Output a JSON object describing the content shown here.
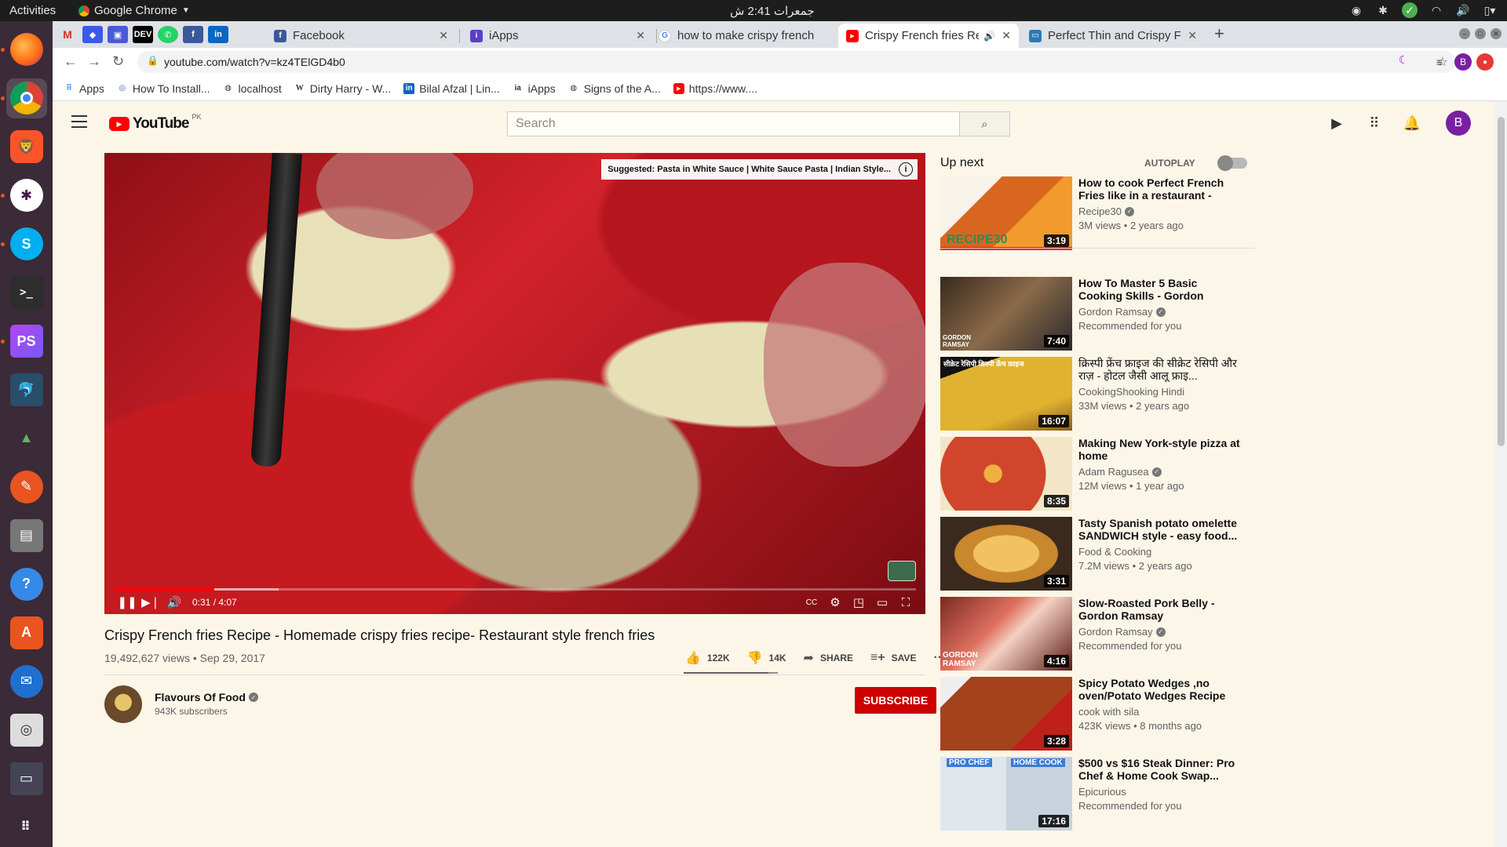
{
  "os": {
    "activities": "Activities",
    "app_menu": "Google Chrome",
    "clock": "جمعرات 2:41 ش"
  },
  "dock": [
    "firefox",
    "chrome",
    "brave",
    "slack",
    "skype",
    "terminal",
    "phpstorm",
    "mysql-workbench",
    "inkscape",
    "scratch",
    "files",
    "help",
    "software-center",
    "thunderbird",
    "rhythmbox",
    "screen",
    "show-apps"
  ],
  "browser": {
    "pinned_tabs": [
      "gmail",
      "plex",
      "app",
      "dev",
      "whatsapp",
      "facebook",
      "linkedin"
    ],
    "tabs": [
      {
        "title": "Facebook",
        "fav_color": "#3b5998",
        "fav": "f"
      },
      {
        "title": "iApps",
        "fav_color": "#5a3ec8",
        "fav": "i"
      },
      {
        "title": "how to make crispy french",
        "fav_color": "#4285f4",
        "fav": "G"
      },
      {
        "title": "Crispy French fries Rec",
        "fav_color": "#f00",
        "fav": "▶",
        "active": true
      },
      {
        "title": "Perfect Thin and Crispy Fr",
        "fav_color": "#2a7ab8",
        "fav": "▭"
      }
    ],
    "url": "youtube.com/watch?v=kz4TElGD4b0",
    "profile_initial": "B",
    "bookmarks": [
      {
        "label": "Apps",
        "icon": "apps-grid-icon"
      },
      {
        "label": "How To Install...",
        "icon": "blue-swirl-icon"
      },
      {
        "label": "localhost",
        "icon": "globe-icon"
      },
      {
        "label": "Dirty Harry - W...",
        "icon": "wikipedia-icon"
      },
      {
        "label": "Bilal Afzal | Lin...",
        "icon": "linkedin-icon"
      },
      {
        "label": "iApps",
        "icon": "iapps-icon"
      },
      {
        "label": "Signs of the A...",
        "icon": "globe-icon"
      },
      {
        "label": "https://www....",
        "icon": "youtube-icon"
      }
    ]
  },
  "youtube": {
    "logo_text": "YouTube",
    "country": "PK",
    "search_placeholder": "Search",
    "avatar_initial": "B",
    "player": {
      "suggestion": "Suggested: Pasta in White Sauce | White Sauce Pasta | Indian Style...",
      "time": "0:31 / 4:07",
      "progress_played": 0.125,
      "progress_loaded": 0.205
    },
    "video": {
      "title": "Crispy French fries Recipe - Homemade crispy fries recipe- Restaurant style french fries",
      "meta": "19,492,627 views • Sep 29, 2017",
      "likes": "122K",
      "dislikes": "14K",
      "share": "SHARE",
      "save": "SAVE",
      "like_ratio": 0.9
    },
    "channel": {
      "name": "Flavours Of Food",
      "subs": "943K subscribers",
      "subscribe": "SUBSCRIBE"
    },
    "sidebar": {
      "up_next": "Up next",
      "autoplay": "AUTOPLAY",
      "items": [
        {
          "title": "How to cook Perfect French Fries like in a restaurant - Best...",
          "channel": "Recipe30",
          "meta": "3M views • 2 years ago",
          "duration": "3:19",
          "thumb_color": "#c8561d",
          "watched": 1.0
        },
        {
          "title": "How To Master 5 Basic Cooking Skills - Gordon Ramsay",
          "channel": "Gordon Ramsay",
          "meta": "Recommended for you",
          "duration": "7:40",
          "thumb_color": "#6b4a2e"
        },
        {
          "title": "क्रिस्पी फ्रेंच फ्राइज की सीक्रेट रेसिपी और राज़ - होटल जैसी आलू फ्राइ...",
          "channel": "CookingShooking Hindi",
          "meta": "33M views • 2 years ago",
          "duration": "16:07",
          "thumb_color": "#d4a02a"
        },
        {
          "title": "Making New York-style pizza at home",
          "channel": "Adam Ragusea",
          "meta": "12M views • 1 year ago",
          "duration": "8:35",
          "thumb_color": "#d0452b"
        },
        {
          "title": "Tasty Spanish potato omelette SANDWICH style - easy food...",
          "channel": "Food & Cooking",
          "meta": "7.2M views • 2 years ago",
          "duration": "3:31",
          "thumb_color": "#d99a3a"
        },
        {
          "title": "Slow-Roasted Pork Belly - Gordon Ramsay",
          "channel": "Gordon Ramsay",
          "meta": "Recommended for you",
          "duration": "4:16",
          "thumb_color": "#b5483a"
        },
        {
          "title": "Spicy Potato Wedges ,no oven/Potato Wedges Recipe",
          "channel": "cook with sila",
          "meta": "423K views • 8 months ago",
          "duration": "3:28",
          "thumb_color": "#9a3a1e"
        },
        {
          "title": "$500 vs $16 Steak Dinner: Pro Chef & Home Cook Swap...",
          "channel": "Epicurious",
          "meta": "Recommended for you",
          "duration": "17:16",
          "thumb_color": "#cfd8e0"
        }
      ]
    }
  }
}
